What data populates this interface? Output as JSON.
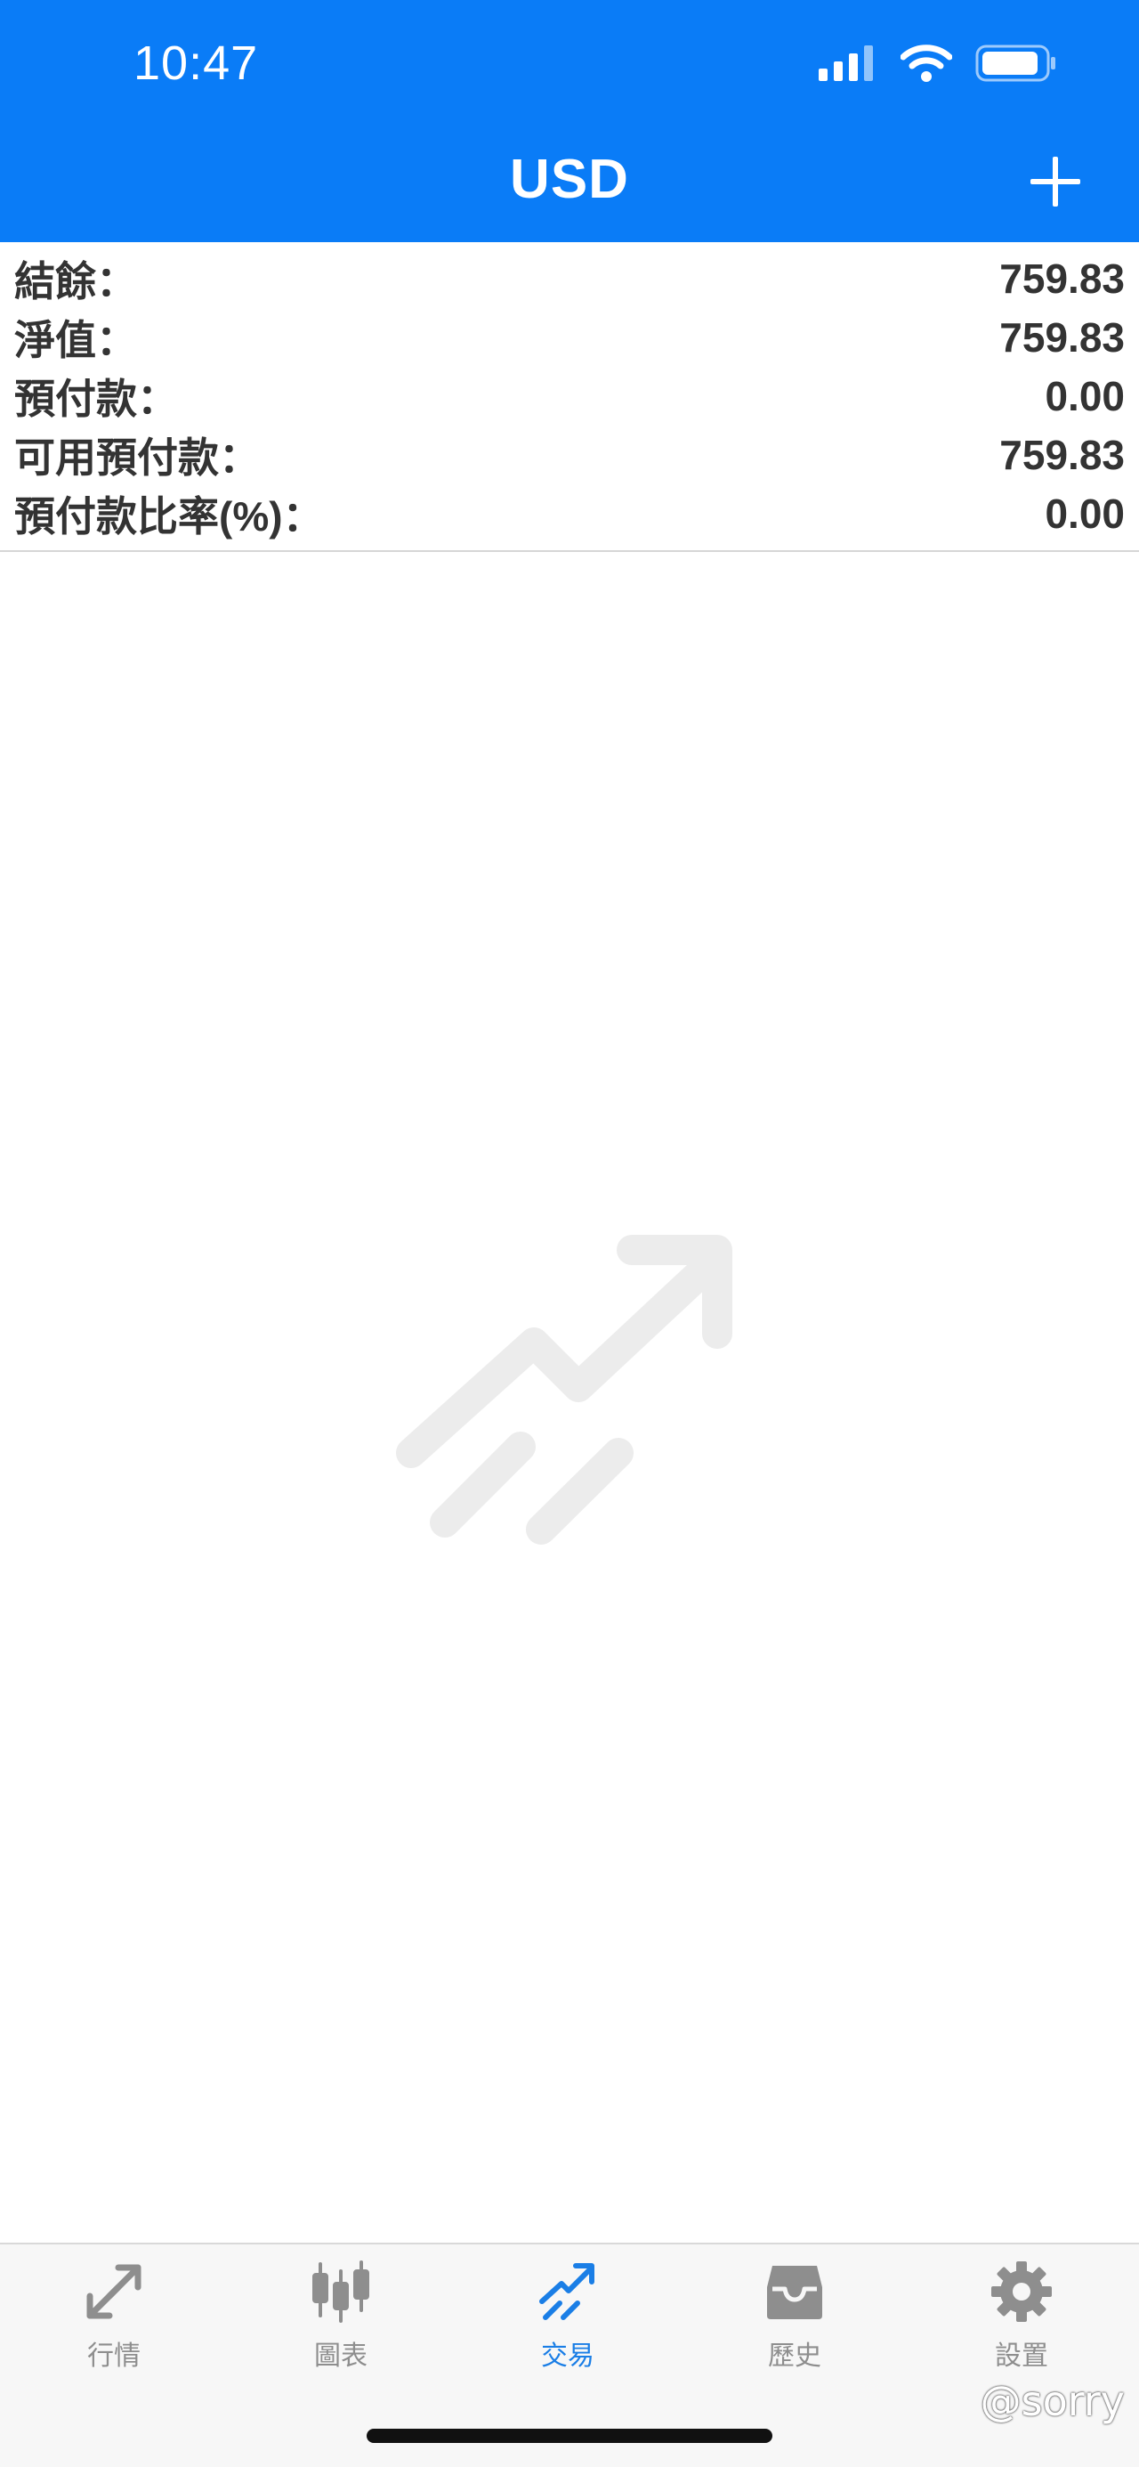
{
  "status_bar": {
    "time": "10:47"
  },
  "header": {
    "title": "USD"
  },
  "summary": {
    "rows": [
      {
        "label": "結餘：",
        "value": "759.83"
      },
      {
        "label": "淨值：",
        "value": "759.83"
      },
      {
        "label": "預付款：",
        "value": "0.00"
      },
      {
        "label": "可用預付款：",
        "value": "759.83"
      },
      {
        "label": "預付款比率(%)：",
        "value": "0.00"
      }
    ]
  },
  "tabs": [
    {
      "label": "行情",
      "icon": "quotes-arrows-icon"
    },
    {
      "label": "圖表",
      "icon": "candlestick-chart-icon"
    },
    {
      "label": "交易",
      "icon": "trade-trend-icon",
      "active": true
    },
    {
      "label": "歷史",
      "icon": "inbox-tray-icon"
    },
    {
      "label": "設置",
      "icon": "gear-icon"
    }
  ],
  "watermark": "@sorry",
  "colors": {
    "header_bg": "#0a7cf7",
    "active_tab": "#1a7ee6",
    "inactive_tab": "#8e8e8e"
  }
}
